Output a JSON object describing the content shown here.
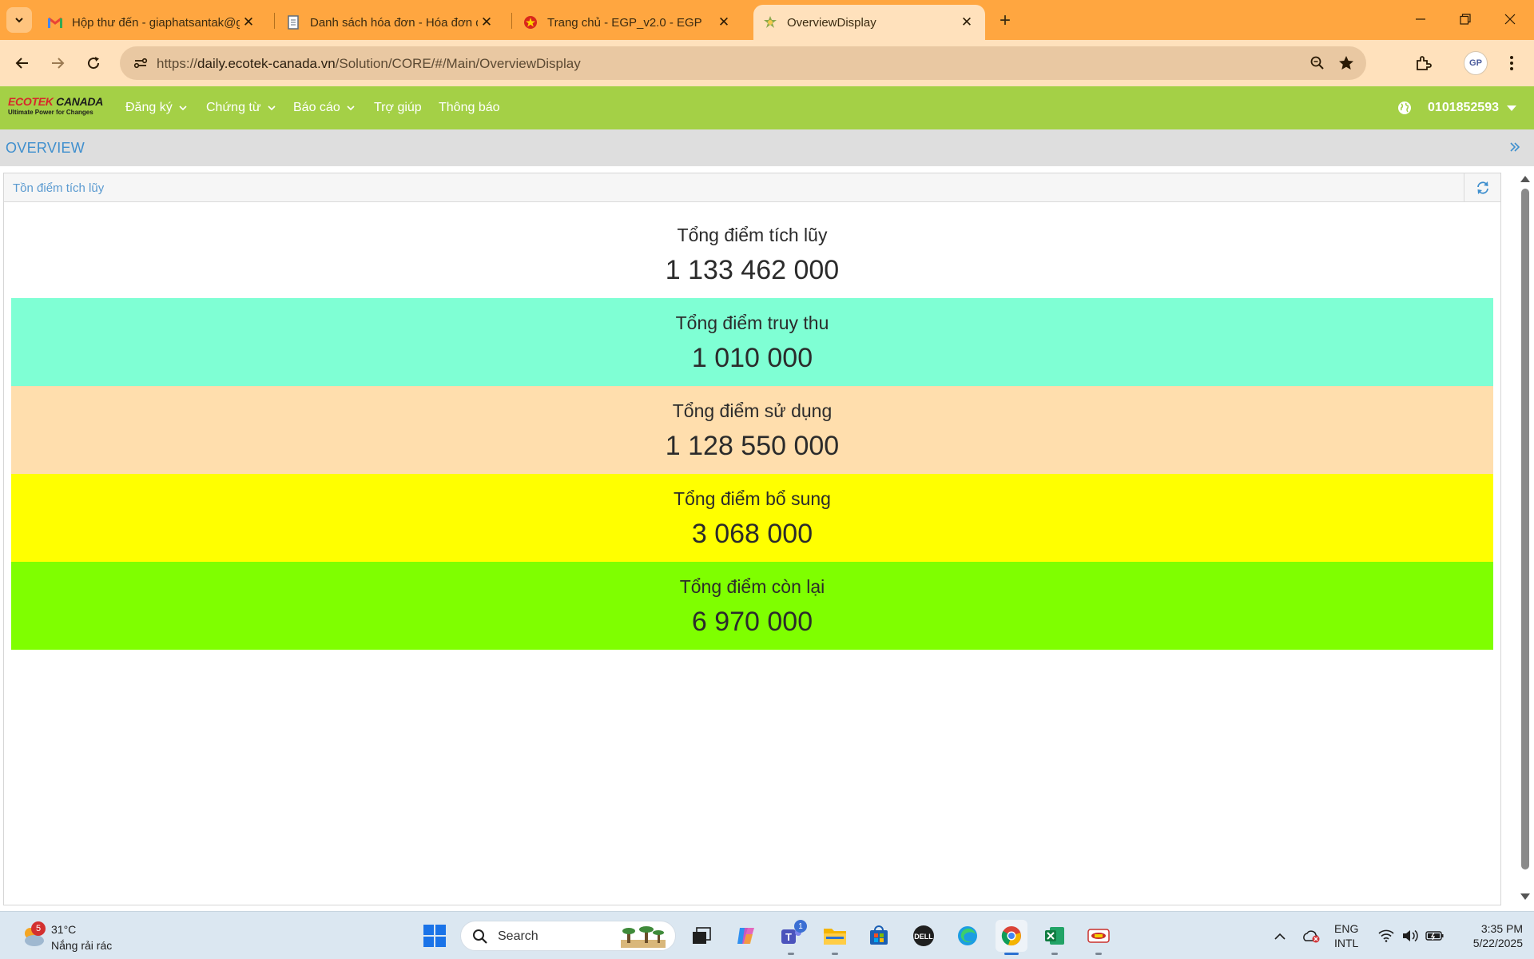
{
  "browser": {
    "tabs": [
      {
        "title": "Hộp thư đến - giaphatsantak@g",
        "icon": "gmail-icon",
        "active": false
      },
      {
        "title": "Danh sách hóa đơn - Hóa đơn đ",
        "icon": "document-icon",
        "active": false
      },
      {
        "title": "Trang chủ - EGP_v2.0 - EGP",
        "icon": "emblem-icon",
        "active": false
      },
      {
        "title": "OverviewDisplay",
        "icon": "app-favicon-icon",
        "active": true
      }
    ],
    "url_prefix": "https://",
    "url_host": "daily.ecotek-canada.vn",
    "url_path": "/Solution/CORE/#/Main/OverviewDisplay",
    "profile_label": "GP"
  },
  "app": {
    "logo_brand_prefix": "ECOTEK",
    "logo_brand_suffix": " CANADA",
    "logo_tagline": "Ultimate Power for Changes",
    "menu": [
      {
        "label": "Đăng ký",
        "dropdown": true
      },
      {
        "label": "Chứng từ",
        "dropdown": true
      },
      {
        "label": "Báo cáo",
        "dropdown": true
      },
      {
        "label": "Trợ giúp",
        "dropdown": false
      },
      {
        "label": "Thông báo",
        "dropdown": false
      }
    ],
    "account_id": "0101852593",
    "breadcrumb": "OVERVIEW",
    "accent_color": "#a4d046"
  },
  "panel": {
    "title": "Tồn điểm tích lũy",
    "stats": [
      {
        "label": "Tổng điểm tích lũy",
        "value": "1 133 462 000",
        "color": "#ffffff"
      },
      {
        "label": "Tổng điểm truy thu",
        "value": "1 010 000",
        "color": "#7fffd4"
      },
      {
        "label": "Tổng điểm sử dụng",
        "value": "1 128 550 000",
        "color": "#ffdead"
      },
      {
        "label": "Tổng điểm bổ sung",
        "value": "3 068 000",
        "color": "#ffff00"
      },
      {
        "label": "Tổng điểm còn lại",
        "value": "6 970 000",
        "color": "#7fff00"
      }
    ]
  },
  "taskbar": {
    "weather_badge": "5",
    "weather_temp": "31°C",
    "weather_desc": "Nắng rải rác",
    "search_placeholder": "Search",
    "teams_badge": "1",
    "lang_line1": "ENG",
    "lang_line2": "INTL",
    "time": "3:35 PM",
    "date": "5/22/2025"
  }
}
